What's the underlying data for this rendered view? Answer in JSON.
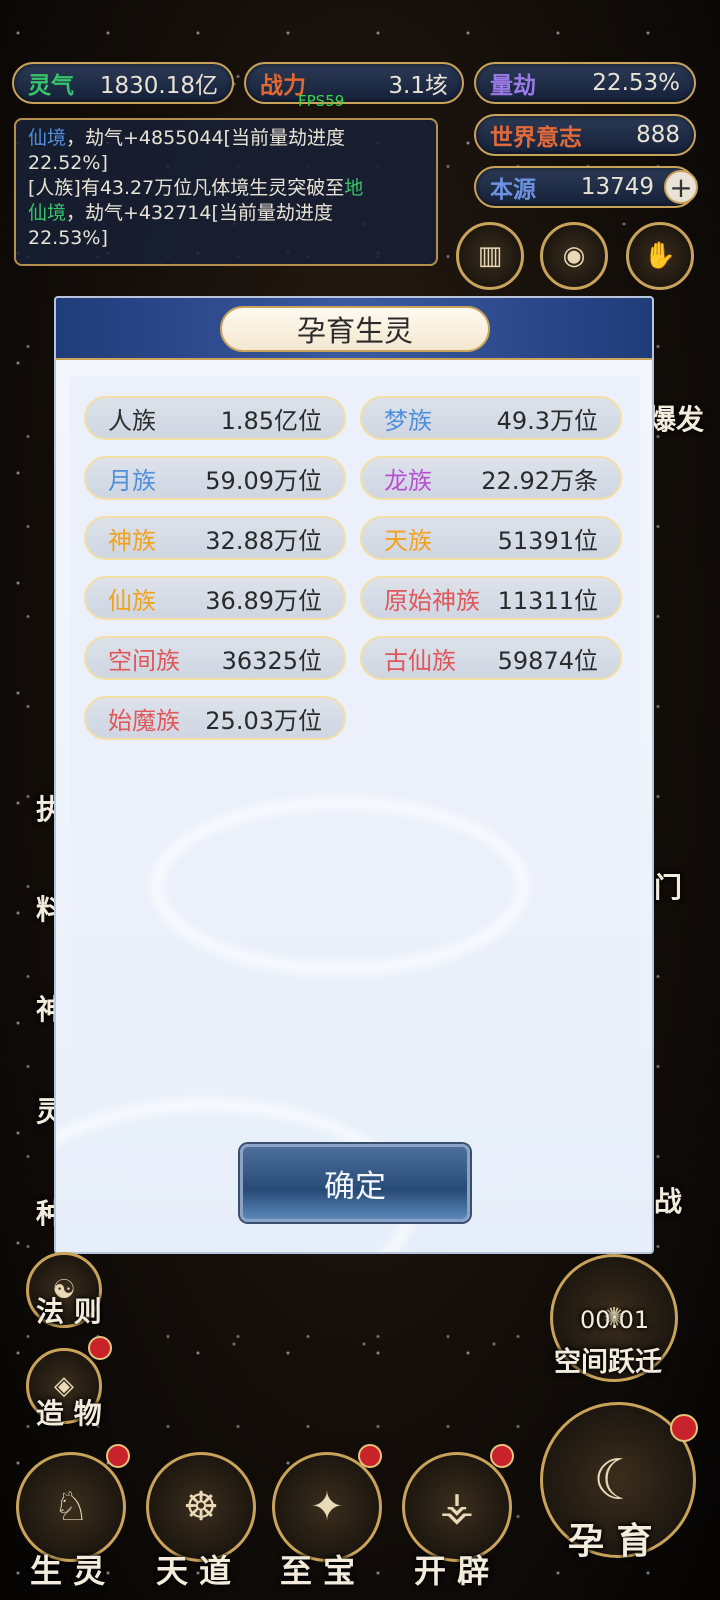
{
  "stats": {
    "lingqi": {
      "label": "灵气",
      "value": "1830.18亿"
    },
    "zhanli": {
      "label": "战力",
      "value": "3.1垓"
    },
    "liangjie": {
      "label": "量劫",
      "value": "22.53%"
    },
    "shijie": {
      "label": "世界意志",
      "value": "888"
    },
    "benyuan": {
      "label": "本源",
      "value": "13749"
    }
  },
  "fps": "FPS59",
  "log": {
    "l1a": "仙境",
    "l1b": "，劫气+4855044[当前量劫进度",
    "l2": "22.52%]",
    "l3a": "[人族]有43.27万位凡体境生灵突破至",
    "l3b": "地",
    "l4a": "仙境",
    "l4b": "，劫气+432714[当前量劫进度",
    "l5": "22.53%]"
  },
  "modal": {
    "title": "孕育生灵",
    "confirm": "确定",
    "races": [
      {
        "name": "人族",
        "value": "1.85亿位",
        "color": "#2f2f2f"
      },
      {
        "name": "梦族",
        "value": "49.3万位",
        "color": "#4f8fdc"
      },
      {
        "name": "月族",
        "value": "59.09万位",
        "color": "#4f8fdc"
      },
      {
        "name": "龙族",
        "value": "22.92万条",
        "color": "#b84fd3"
      },
      {
        "name": "神族",
        "value": "32.88万位",
        "color": "#f0a21c"
      },
      {
        "name": "天族",
        "value": "51391位",
        "color": "#f0a21c"
      },
      {
        "name": "仙族",
        "value": "36.89万位",
        "color": "#f0a21c"
      },
      {
        "name": "原始神族",
        "value": "11311位",
        "color": "#e0575a"
      },
      {
        "name": "空间族",
        "value": "36325位",
        "color": "#e0575a"
      },
      {
        "name": "古仙族",
        "value": "59874位",
        "color": "#e0575a"
      },
      {
        "name": "始魔族",
        "value": "25.03万位",
        "color": "#e0575a"
      }
    ]
  },
  "side_left": {
    "fazhe": "法 则",
    "zaowu": "造 物",
    "partial": [
      "执",
      "料",
      "神",
      "灵",
      "种"
    ]
  },
  "side_right": {
    "partial_top": "爆发",
    "partial": [
      "门",
      "战"
    ],
    "timer": "00:01",
    "kongjian": "空间跃迁"
  },
  "bottom_nav": {
    "shengling": "生 灵",
    "tiandao": "天 道",
    "zhibao": "至 宝",
    "kaipi": "开 辟",
    "yunyu": "孕 育"
  },
  "colors": {
    "gold": "#c9a35a",
    "lingqi": "#38c46a",
    "zhanli": "#e2682f",
    "liangjie": "#8a6ad8",
    "shijie": "#e26a3a",
    "benyuan": "#6b93e0",
    "xianjing": "#4f8fdc",
    "dixian": "#38c46a"
  },
  "icons": [
    "plus-icon",
    "scroll-icon",
    "eye-icon",
    "hand-icon"
  ]
}
